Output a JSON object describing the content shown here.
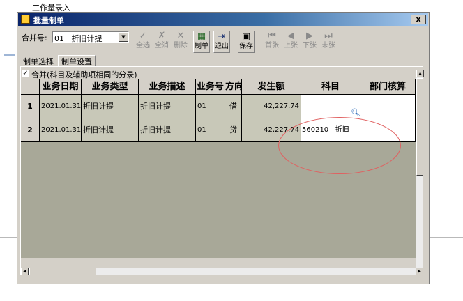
{
  "background": {
    "title": "工作量录入"
  },
  "window": {
    "title": "批量制单",
    "close_label": "x"
  },
  "toolbar": {
    "merge_label": "合并号:",
    "merge_value": "01   折旧计提",
    "buttons": {
      "select_all": "全选",
      "deselect_all": "全消",
      "delete": "删除",
      "make_voucher": "制单",
      "exit": "退出",
      "save": "保存",
      "first": "首张",
      "prev": "上张",
      "next": "下张",
      "last": "末张"
    }
  },
  "tabs": [
    "制单选择",
    "制单设置"
  ],
  "merge_option": {
    "checked": true,
    "label": "合并(科目及辅助项相同的分录)"
  },
  "table": {
    "columns": [
      "业务日期",
      "业务类型",
      "业务描述",
      "业务号",
      "方向",
      "发生额",
      "科目",
      "部门核算"
    ],
    "rows": [
      {
        "no": "1",
        "date": "2021.01.31",
        "type": "折旧计提",
        "desc": "折旧计提",
        "biz_no": "01",
        "direction": "借",
        "amount": "42,227.74",
        "subject": "",
        "dept": ""
      },
      {
        "no": "2",
        "date": "2021.01.31",
        "type": "折旧计提",
        "desc": "折旧计提",
        "biz_no": "01",
        "direction": "贷",
        "amount": "42,227.74",
        "subject": "560210   折旧",
        "dept": ""
      }
    ]
  },
  "colors": {
    "annotation": "#e06060",
    "grid_bg": "#a8a898",
    "title_bar": "#0a246a"
  }
}
